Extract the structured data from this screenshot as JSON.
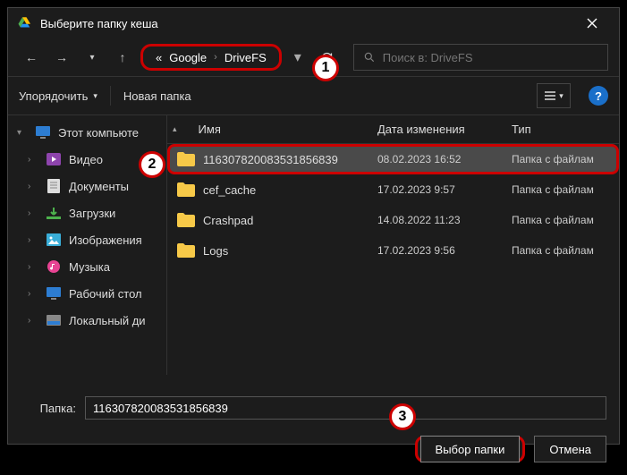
{
  "title": "Выберите папку кеша",
  "breadcrumb": {
    "more": "«",
    "p1": "Google",
    "p2": "DriveFS"
  },
  "search": {
    "placeholder": "Поиск в: DriveFS"
  },
  "toolbar": {
    "organize": "Упорядочить",
    "newFolder": "Новая папка"
  },
  "columns": {
    "name": "Имя",
    "date": "Дата изменения",
    "type": "Тип"
  },
  "sidebar": {
    "top": "Этот компьюте",
    "items": [
      {
        "label": "Видео"
      },
      {
        "label": "Документы"
      },
      {
        "label": "Загрузки"
      },
      {
        "label": "Изображения"
      },
      {
        "label": "Музыка"
      },
      {
        "label": "Рабочий стол"
      },
      {
        "label": "Локальный ди"
      }
    ]
  },
  "rows": [
    {
      "name": "116307820083531856839",
      "date": "08.02.2023 16:52",
      "type": "Папка с файлам"
    },
    {
      "name": "cef_cache",
      "date": "17.02.2023 9:57",
      "type": "Папка с файлам"
    },
    {
      "name": "Crashpad",
      "date": "14.08.2022 11:23",
      "type": "Папка с файлам"
    },
    {
      "name": "Logs",
      "date": "17.02.2023 9:56",
      "type": "Папка с файлам"
    }
  ],
  "folderField": {
    "label": "Папка:",
    "value": "116307820083531856839"
  },
  "buttons": {
    "select": "Выбор папки",
    "cancel": "Отмена"
  },
  "callouts": {
    "c1": "1",
    "c2": "2",
    "c3": "3"
  }
}
